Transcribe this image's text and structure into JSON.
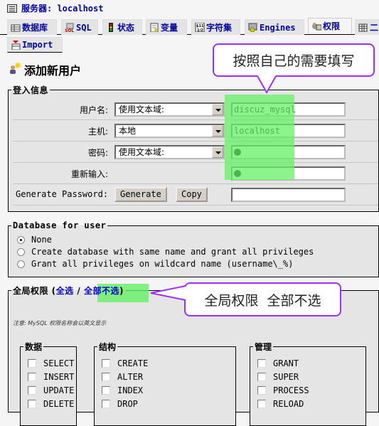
{
  "header": {
    "server_label": "服务器: localhost"
  },
  "tabs": [
    {
      "label": "数据库",
      "icon": "database-icon"
    },
    {
      "label": "SQL",
      "icon": "sql-icon"
    },
    {
      "label": "状态",
      "icon": "traffic-light-icon"
    },
    {
      "label": "变量",
      "icon": "notepad-icon"
    },
    {
      "label": "字符集",
      "icon": "charset-icon"
    },
    {
      "label": "Engines",
      "icon": "engines-icon"
    },
    {
      "label": "权限",
      "icon": "privileges-icon",
      "active": true
    },
    {
      "label": "二",
      "icon": "binlog-icon"
    },
    {
      "label": "Import",
      "icon": "import-icon"
    }
  ],
  "page_title": "添加新用户",
  "callouts": {
    "fill_as_needed": "按照自己的需要填写",
    "global_none": "全局权限  全部不选"
  },
  "login": {
    "legend": "登入信息",
    "username": {
      "label": "用户名:",
      "select": "使用文本域:",
      "value": "discuz_mysql"
    },
    "host": {
      "label": "主机:",
      "select": "本地",
      "value": "localhost"
    },
    "password": {
      "label": "密码:",
      "select": "使用文本域:",
      "value": "●"
    },
    "retype": {
      "label": "重新输入:",
      "value": "●"
    },
    "generate": {
      "label": "Generate Password:",
      "generate_button": "Generate",
      "copy_button": "Copy",
      "value": ""
    }
  },
  "database_for_user": {
    "legend": "Database for user",
    "options": [
      {
        "label": "None",
        "checked": true
      },
      {
        "label": "Create database with same name and grant all privileges",
        "checked": false
      },
      {
        "label": "Grant all privileges on wildcard name (username\\_%)",
        "checked": false
      }
    ]
  },
  "global_privileges": {
    "legend_prefix": "全局权限 (",
    "select_all": "全选",
    "separator": " / ",
    "select_none": "全部不选",
    "legend_suffix": ")",
    "note": "注意: MySQL 权限名称会以英文显示",
    "groups": [
      {
        "legend": "数据",
        "items": [
          "SELECT",
          "INSERT",
          "UPDATE",
          "DELETE"
        ]
      },
      {
        "legend": "结构",
        "items": [
          "CREATE",
          "ALTER",
          "INDEX",
          "DROP"
        ]
      },
      {
        "legend": "管理",
        "items": [
          "GRANT",
          "SUPER",
          "PROCESS",
          "RELOAD"
        ]
      }
    ]
  }
}
